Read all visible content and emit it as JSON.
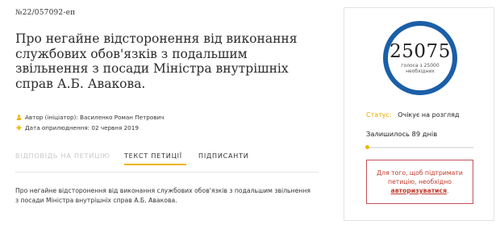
{
  "petition": {
    "number": "№22/057092-еп",
    "title": "Про негайне відсторонення від виконання службових обов'язків з подальшим звільнення з посади Міністра внутрішніх справ А.Б. Авакова.",
    "author": "Автор (ініціатор): Василенко Роман Петрович",
    "date": "Дата оприлюднення: 02 червня 2019",
    "body": "Про негайне відсторонення від виконання службових обов'язків з подальшим звільнення з посади Міністра внутрішніх справ А.Б. Авакова."
  },
  "tabs": {
    "response": "ВІДПОВІДЬ НА ПЕТИЦІЮ",
    "text": "ТЕКСТ ПЕТИЦІЇ",
    "signers": "ПІДПИСАНТИ",
    "active": "text"
  },
  "sidebar": {
    "votes": "25075",
    "votes_caption_line1": "голоса з 25000",
    "votes_caption_line2": "необхідних",
    "status_label": "Статус:",
    "status_value": "Очікує на розгляд",
    "remaining": "Залишилось 89 днів",
    "progress_fraction": 0.02,
    "auth_line1": "Для того, щоб підтримати",
    "auth_line2": "петицію, необхідно",
    "auth_link": "авторизуватися",
    "auth_suffix": "."
  },
  "icons": {
    "author": "person-icon",
    "date": "plus-icon"
  },
  "colors": {
    "accent": "#f0b400",
    "circle": "#1a5fa8",
    "alert": "#c0392b"
  }
}
